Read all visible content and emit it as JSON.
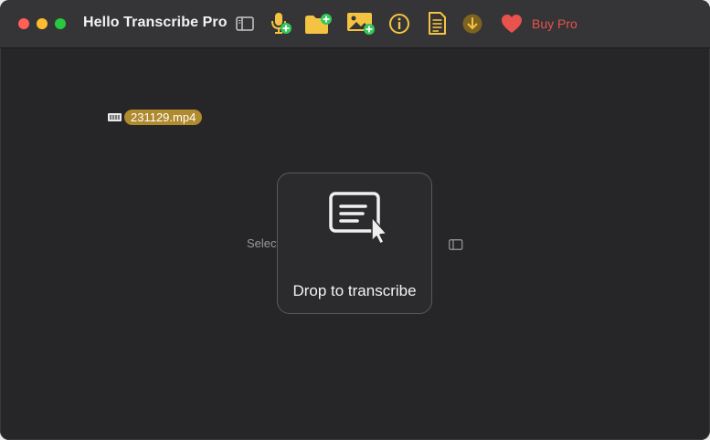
{
  "window": {
    "title": "Hello Transcribe Pro"
  },
  "toolbar": {
    "buttons": [
      {
        "icon": "sidebar-toggle-icon"
      },
      {
        "icon": "add-microphone-icon"
      },
      {
        "icon": "add-folder-icon"
      },
      {
        "icon": "add-image-icon"
      },
      {
        "icon": "info-icon"
      },
      {
        "icon": "document-icon"
      },
      {
        "icon": "download-icon"
      }
    ],
    "buy_pro_label": "Buy Pro",
    "buy_pro_icon": "heart-icon"
  },
  "dragged_file": {
    "name": "231129.mp4"
  },
  "empty_hint": {
    "text": "Select a file in the sidebar"
  },
  "drop_overlay": {
    "label": "Drop to transcribe",
    "icon": "transcribe-cursor-icon"
  },
  "colors": {
    "accent_yellow": "#f5c342",
    "buy_pro_red": "#e8534e",
    "add_badge_green": "#34c759",
    "file_chip": "#b08a2e",
    "background": "#262628"
  }
}
